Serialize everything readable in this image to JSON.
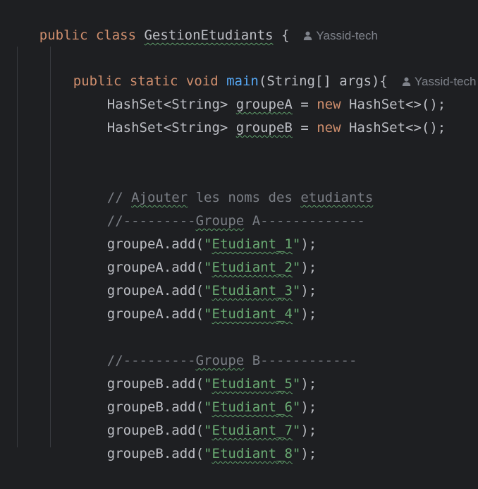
{
  "colors": {
    "background": "#1e1f22",
    "keyword": "#cf8e6d",
    "method": "#56a8f5",
    "string": "#6aab73",
    "comment": "#7a7e85",
    "text": "#bcbec4",
    "inlay_hint": "#7f838b"
  },
  "icons": {
    "author": "person-icon"
  },
  "code": {
    "l1": {
      "kw": "public class ",
      "name": "GestionEtudiants",
      "rest": " {",
      "author": "Yassid-tech"
    },
    "l2": {
      "kw": "public static void ",
      "fn": "main",
      "rest": "(String[] args){",
      "author": "Yassid-tech"
    },
    "l3": {
      "pre": "HashSet<String> ",
      "var": "groupeA",
      "mid": " = ",
      "kw": "new",
      "post": " HashSet<>();"
    },
    "l4": {
      "pre": "HashSet<String> ",
      "var": "groupeB",
      "mid": " = ",
      "kw": "new",
      "post": " HashSet<>();"
    },
    "l5": {
      "a": "// ",
      "b": "Ajouter",
      "c": " les noms des ",
      "d": "etudiants"
    },
    "l6": {
      "a": "//---------",
      "b": "Groupe",
      "c": " A-------------"
    },
    "l7": {
      "pre": "groupeA.add(",
      "q1": "\"",
      "str": "Etudiant_1",
      "q2": "\"",
      "post": ");"
    },
    "l8": {
      "pre": "groupeA.add(",
      "q1": "\"",
      "str": "Etudiant_2",
      "q2": "\"",
      "post": ");"
    },
    "l9": {
      "pre": "groupeA.add(",
      "q1": "\"",
      "str": "Etudiant_3",
      "q2": "\"",
      "post": ");"
    },
    "l10": {
      "pre": "groupeA.add(",
      "q1": "\"",
      "str": "Etudiant_4",
      "q2": "\"",
      "post": ");"
    },
    "l11": {
      "a": "//---------",
      "b": "Groupe",
      "c": " B------------"
    },
    "l12": {
      "pre": "groupeB.add(",
      "q1": "\"",
      "str": "Etudiant_5",
      "q2": "\"",
      "post": ");"
    },
    "l13": {
      "pre": "groupeB.add(",
      "q1": "\"",
      "str": "Etudiant_6",
      "q2": "\"",
      "post": ");"
    },
    "l14": {
      "pre": "groupeB.add(",
      "q1": "\"",
      "str": "Etudiant_7",
      "q2": "\"",
      "post": ");"
    },
    "l15": {
      "pre": "groupeB.add(",
      "q1": "\"",
      "str": "Etudiant_8",
      "q2": "\"",
      "post": ");"
    }
  }
}
